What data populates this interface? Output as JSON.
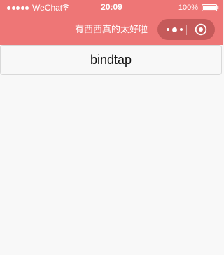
{
  "status_bar": {
    "carrier": "WeChat",
    "time": "20:09",
    "battery_percent": "100%",
    "signal_icon": "signal-dots-icon",
    "wifi_icon": "wifi-icon",
    "battery_icon": "battery-icon"
  },
  "nav_bar": {
    "title": "有西西真的太好啦",
    "background_color": "#ee7676",
    "more_icon": "more-dots-icon",
    "close_icon": "close-circle-icon"
  },
  "main": {
    "button_label": "bindtap"
  }
}
